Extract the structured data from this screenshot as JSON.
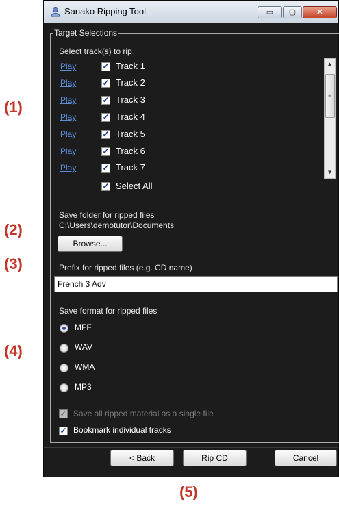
{
  "callouts": [
    "(1)",
    "(2)",
    "(3)",
    "(4)",
    "(5)"
  ],
  "window": {
    "title": "Sanako Ripping Tool",
    "minimize": "▭",
    "maximize": "▢",
    "close": "✕"
  },
  "target": {
    "group_title": "Target Selections",
    "select_label": "Select track(s) to rip",
    "play_label": "Play",
    "tracks": [
      {
        "label": "Track 1",
        "checked": true
      },
      {
        "label": "Track 2",
        "checked": true
      },
      {
        "label": "Track 3",
        "checked": true
      },
      {
        "label": "Track 4",
        "checked": true
      },
      {
        "label": "Track 5",
        "checked": true
      },
      {
        "label": "Track 6",
        "checked": true
      },
      {
        "label": "Track 7",
        "checked": true
      }
    ],
    "select_all": {
      "label": "Select All",
      "checked": true
    }
  },
  "save_folder": {
    "label": "Save folder for ripped files",
    "path": "C:\\Users\\demotutor\\Documents",
    "browse_label": "Browse..."
  },
  "prefix": {
    "label": "Prefix for ripped files (e.g. CD name)",
    "value": "French 3 Adv"
  },
  "format": {
    "label": "Save format for ripped files",
    "options": [
      {
        "label": "MFF",
        "selected": true
      },
      {
        "label": "WAV",
        "selected": false
      },
      {
        "label": "WMA",
        "selected": false
      },
      {
        "label": "MP3",
        "selected": false
      }
    ]
  },
  "options": {
    "single_file": {
      "label": "Save all ripped material as a single file",
      "checked": true,
      "disabled": true
    },
    "bookmark": {
      "label": "Bookmark individual tracks",
      "checked": true
    }
  },
  "buttons": {
    "back": "< Back",
    "rip": "Rip CD",
    "cancel": "Cancel"
  },
  "colors": {
    "link": "#5a8fdc",
    "callout": "#c0392b",
    "window_bg": "#1c1c1c"
  }
}
